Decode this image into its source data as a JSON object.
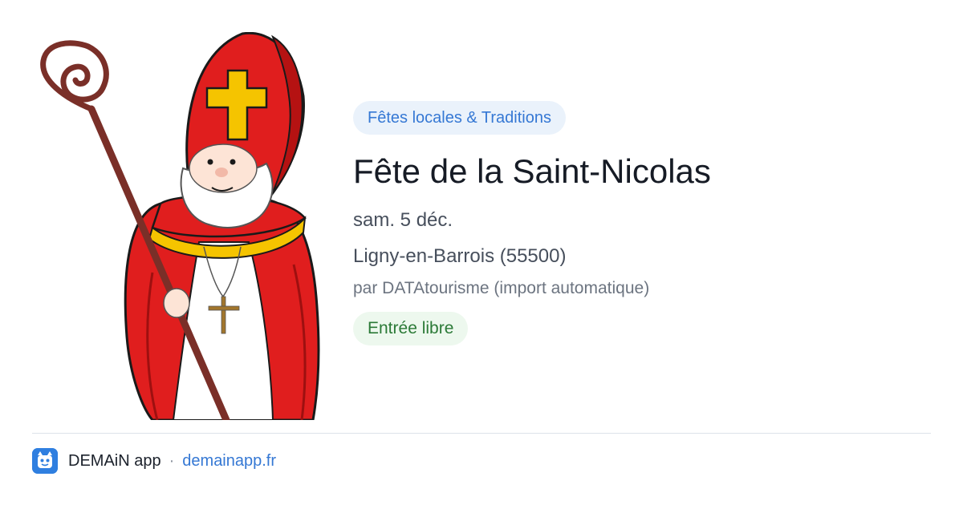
{
  "category": "Fêtes locales & Traditions",
  "title": "Fête de la Saint-Nicolas",
  "date": "sam. 5 déc.",
  "location": "Ligny-en-Barrois (55500)",
  "source": "par DATAtourisme (import automatique)",
  "price": "Entrée libre",
  "footer": {
    "app_name": "DEMAiN app",
    "separator": "·",
    "link": "demainapp.fr"
  },
  "image": {
    "subject": "saint-nicolas-illustration"
  },
  "colors": {
    "category_bg": "#eaf2fb",
    "category_text": "#3578d4",
    "price_bg": "#edf8ee",
    "price_text": "#2b7a37",
    "link": "#3578d4",
    "robe_red": "#e01e1e",
    "gold": "#f5c400"
  }
}
